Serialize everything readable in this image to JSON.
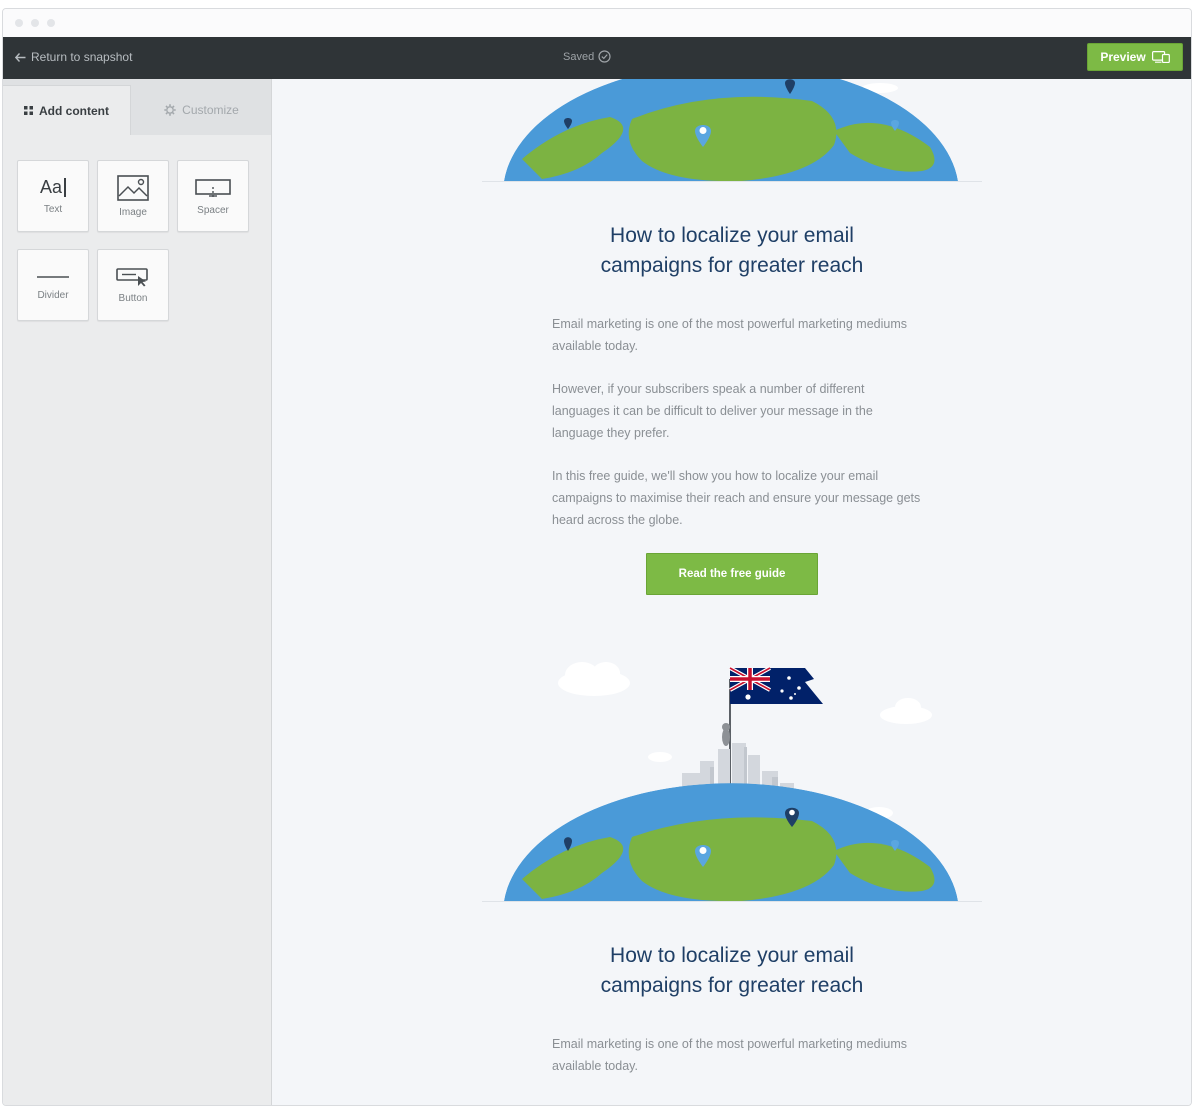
{
  "topbar": {
    "back_label": "Return to snapshot",
    "saved_label": "Saved",
    "preview_label": "Preview"
  },
  "sidebar": {
    "tabs": [
      {
        "label": "Add content",
        "active": true
      },
      {
        "label": "Customize",
        "active": false
      }
    ],
    "tiles": [
      {
        "label": "Text",
        "icon": "text-icon"
      },
      {
        "label": "Image",
        "icon": "image-icon"
      },
      {
        "label": "Spacer",
        "icon": "spacer-icon"
      },
      {
        "label": "Divider",
        "icon": "divider-icon"
      },
      {
        "label": "Button",
        "icon": "button-icon"
      }
    ],
    "text_icon_glyph": "Aa"
  },
  "email": {
    "headline_line1": "How to localize your email",
    "headline_line2": "campaigns for greater reach",
    "paragraphs": [
      "Email marketing is one of the most powerful marketing mediums available today.",
      "However, if your subscribers speak a number of different languages it can be difficult to deliver your message in the language they prefer.",
      "In this free guide, we'll show you how to localize your email campaigns to maximise their reach and ensure your message gets heard across the globe."
    ],
    "cta_label": "Read the free guide",
    "second_headline_line1": "How to localize your email",
    "second_headline_line2": "campaigns for greater reach",
    "second_paragraph": "Email marketing is one of the most powerful marketing mediums available today."
  },
  "colors": {
    "accent_green": "#7dba45",
    "topbar": "#2f3437",
    "headline_navy": "#1f3f66",
    "ocean": "#4a9ad8",
    "land": "#7cb342",
    "flag_blue": "#012169",
    "flag_red": "#c8102e"
  }
}
